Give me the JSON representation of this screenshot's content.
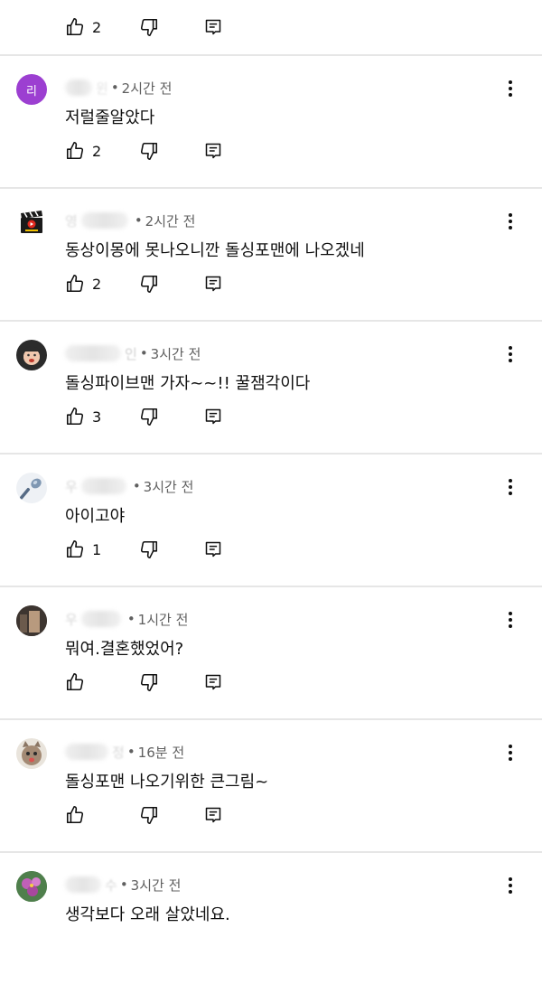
{
  "top_actions": {
    "like_count": "2"
  },
  "comments": [
    {
      "avatar_letter": "리",
      "avatar_color": "#9c3fd1",
      "name_partial": "윈",
      "time": "2시간 전",
      "text": "저럴줄알았다",
      "like_count": "2"
    },
    {
      "avatar_letter": "",
      "avatar_color": "#ffffff",
      "name_partial": "영",
      "time": "2시간 전",
      "text": "동상이몽에 못나오니깐 돌싱포맨에 나오겠네",
      "like_count": "2"
    },
    {
      "avatar_letter": "",
      "avatar_color": "#d8b39a",
      "name_partial": "인",
      "time": "3시간 전",
      "text": "돌싱파이브맨 가자~~!! 꿀잼각이다",
      "like_count": "3"
    },
    {
      "avatar_letter": "",
      "avatar_color": "#c9ced6",
      "name_partial": "우",
      "time": "3시간 전",
      "text": "아이고야",
      "like_count": "1"
    },
    {
      "avatar_letter": "",
      "avatar_color": "#7a6a5d",
      "name_partial": "우",
      "time": "1시간 전",
      "text": "뭐여.결혼했었어?",
      "like_count": ""
    },
    {
      "avatar_letter": "",
      "avatar_color": "#a38a74",
      "name_partial": "정",
      "time": "16분 전",
      "text": "돌싱포맨 나오기위한 큰그림~",
      "like_count": ""
    },
    {
      "avatar_letter": "",
      "avatar_color": "#b05aa8",
      "name_partial": "수",
      "time": "3시간 전",
      "text": "생각보다 오래 살았네요.",
      "like_count": ""
    }
  ],
  "icons": {
    "like": "thumbs-up-icon",
    "dislike": "thumbs-down-icon",
    "reply": "comment-reply-icon",
    "more": "more-vertical-icon"
  }
}
